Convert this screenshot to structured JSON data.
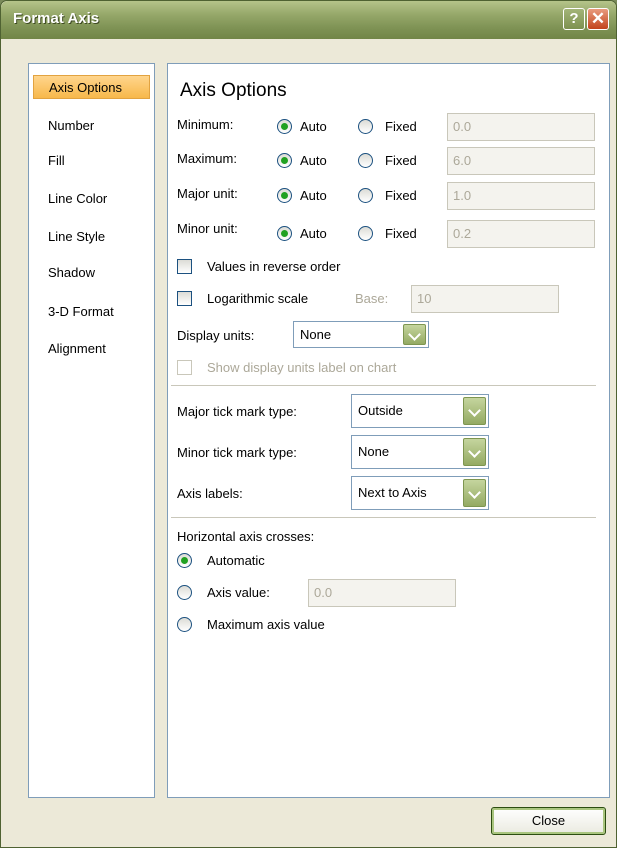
{
  "window": {
    "title": "Format Axis",
    "help_label": "?",
    "close_label": "✕"
  },
  "nav": {
    "items": [
      "Axis Options",
      "Number",
      "Fill",
      "Line Color",
      "Line Style",
      "Shadow",
      "3-D Format",
      "Alignment"
    ],
    "selected": "Axis Options"
  },
  "panel": {
    "heading": "Axis Options",
    "rows": [
      {
        "label": "Minimum:",
        "auto": "Auto",
        "fixed": "Fixed",
        "value": "0.0",
        "mode": "auto"
      },
      {
        "label": "Maximum:",
        "auto": "Auto",
        "fixed": "Fixed",
        "value": "6.0",
        "mode": "auto"
      },
      {
        "label": "Major unit:",
        "auto": "Auto",
        "fixed": "Fixed",
        "value": "1.0",
        "mode": "auto"
      },
      {
        "label": "Minor unit:",
        "auto": "Auto",
        "fixed": "Fixed",
        "value": "0.2",
        "mode": "auto"
      }
    ],
    "reverse_order": {
      "label": "Values in reverse order",
      "checked": false
    },
    "log_scale": {
      "label": "Logarithmic scale",
      "checked": false,
      "base_label": "Base:",
      "base_value": "10"
    },
    "display_units": {
      "label": "Display units:",
      "value": "None"
    },
    "show_units_label": {
      "label": "Show display units label on chart",
      "checked": false,
      "enabled": false
    },
    "major_tick": {
      "label": "Major tick mark type:",
      "value": "Outside"
    },
    "minor_tick": {
      "label": "Minor tick mark type:",
      "value": "None"
    },
    "axis_labels": {
      "label": "Axis labels:",
      "value": "Next to Axis"
    },
    "crosses": {
      "label": "Horizontal axis crosses:",
      "options": [
        "Automatic",
        "Axis value:",
        "Maximum axis value"
      ],
      "selected": "Automatic",
      "axis_value": "0.0"
    }
  },
  "footer": {
    "close_label": "Close"
  }
}
